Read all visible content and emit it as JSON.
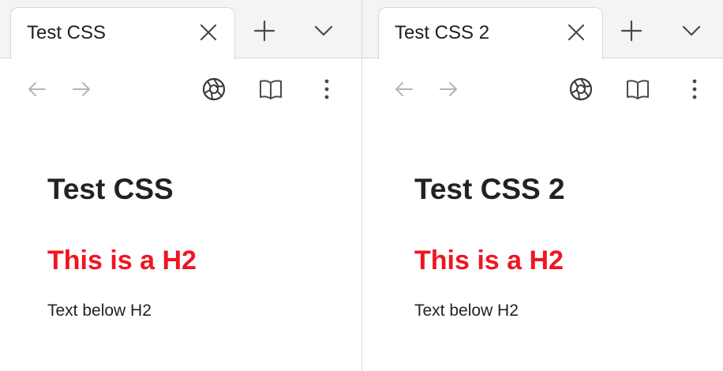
{
  "windows": [
    {
      "tab": {
        "title": "Test CSS"
      },
      "page": {
        "h1": "Test CSS",
        "h2": "This is a H2",
        "paragraph": "Text below H2"
      }
    },
    {
      "tab": {
        "title": "Test CSS 2"
      },
      "page": {
        "h1": "Test CSS 2",
        "h2": "This is a H2",
        "paragraph": "Text below H2"
      }
    }
  ],
  "icons": {
    "close": "close-icon",
    "new_tab": "plus-icon",
    "tab_list": "chevron-down-icon",
    "back": "arrow-left-icon",
    "forward": "arrow-right-icon",
    "screenshot": "camera-aperture-icon",
    "reader": "open-book-icon",
    "menu": "vertical-ellipsis-icon"
  },
  "colors": {
    "h2": "#f01522",
    "text": "#222222",
    "tabstrip": "#f4f4f4",
    "disabled_nav": "#b4b4b4",
    "icon": "#4a4a4a"
  }
}
